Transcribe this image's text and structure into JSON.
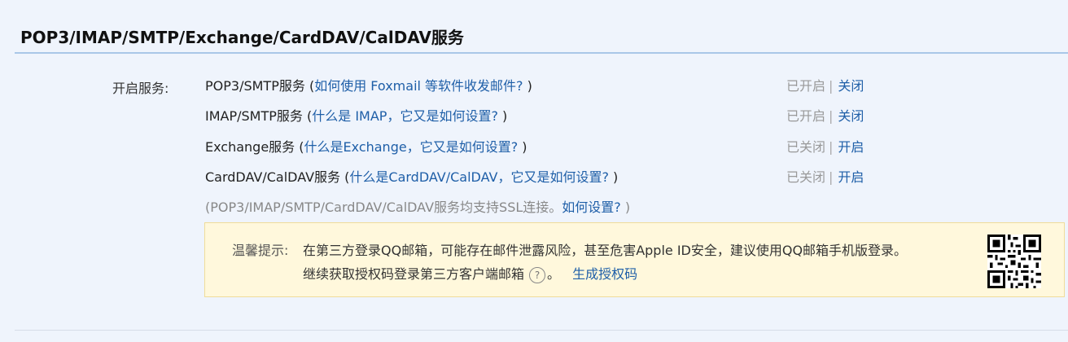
{
  "header": {
    "title": "POP3/IMAP/SMTP/Exchange/CardDAV/CalDAV服务"
  },
  "services": {
    "label": "开启服务:",
    "items": [
      {
        "name": "POP3/SMTP服务",
        "open_paren": " (",
        "link": "如何使用 Foxmail 等软件收发邮件?",
        "close_paren": " )",
        "status": "已开启",
        "action": "关闭"
      },
      {
        "name": "IMAP/SMTP服务",
        "open_paren": " (",
        "link": "什么是 IMAP，它又是如何设置?",
        "close_paren": " )",
        "status": "已开启",
        "action": "关闭"
      },
      {
        "name": "Exchange服务",
        "open_paren": " (",
        "link": "什么是Exchange，它又是如何设置?",
        "close_paren": " )",
        "status": "已关闭",
        "action": "开启"
      },
      {
        "name": "CardDAV/CalDAV服务",
        "open_paren": " (",
        "link": "什么是CardDAV/CalDAV，它又是如何设置?",
        "close_paren": " )",
        "status": "已关闭",
        "action": "开启"
      }
    ],
    "separator": "|",
    "ssl_note_prefix": "(POP3/IMAP/SMTP/CardDAV/CalDAV服务均支持SSL连接。",
    "ssl_note_link": "如何设置?",
    "ssl_note_suffix": " )"
  },
  "tip": {
    "label": "温馨提示:",
    "line1": "在第三方登录QQ邮箱，可能存在邮件泄露风险，甚至危害Apple ID安全，建议使用QQ邮箱手机版登录。",
    "line2": "继续获取授权码登录第三方客户端邮箱",
    "help_glyph": "?",
    "after_help": "。",
    "generate_link": "生成授权码"
  },
  "icons": {
    "help": "help-circle-icon",
    "qr": "qr-code-icon"
  },
  "colors": {
    "background": "#eff4fc",
    "link": "#1f5fa8",
    "muted": "#999999",
    "tip_background": "#fff8dc",
    "title_underline": "#a9c7e8"
  }
}
